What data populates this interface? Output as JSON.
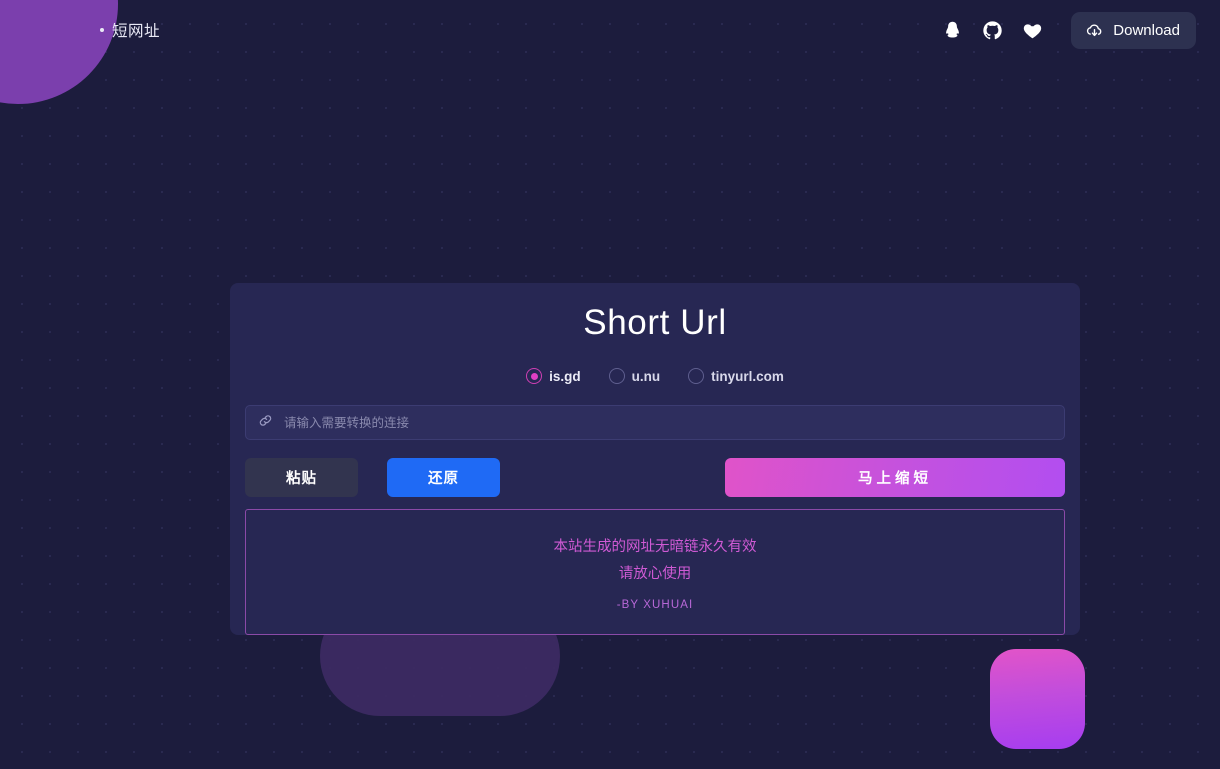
{
  "header": {
    "brand": "短网址",
    "icons": [
      {
        "name": "qq-icon",
        "label": "QQ"
      },
      {
        "name": "github-icon",
        "label": "GitHub"
      },
      {
        "name": "heart-icon",
        "label": "Favorite"
      }
    ],
    "download_label": "Download",
    "download_icon": "cloud-download-icon"
  },
  "card": {
    "title": "Short Url",
    "providers": [
      {
        "label": "is.gd",
        "selected": true
      },
      {
        "label": "u.nu",
        "selected": false
      },
      {
        "label": "tinyurl.com",
        "selected": false
      }
    ],
    "input": {
      "icon": "link-icon",
      "placeholder": "请输入需要转换的连接",
      "value": ""
    },
    "buttons": {
      "paste": "粘贴",
      "restore": "还原",
      "shorten": "马上缩短"
    },
    "notice": {
      "line1": "本站生成的网址无暗链永久有效",
      "line2": "请放心使用",
      "author": "-BY XUHUAI"
    }
  },
  "colors": {
    "background": "#1c1c3d",
    "card": "#272753",
    "accent_magenta": "#e03fc4",
    "accent_purple": "#b24ef0",
    "accent_blue": "#1f6af5",
    "notice_border": "#8b4aa8",
    "blob_purple": "#7b3fad"
  }
}
